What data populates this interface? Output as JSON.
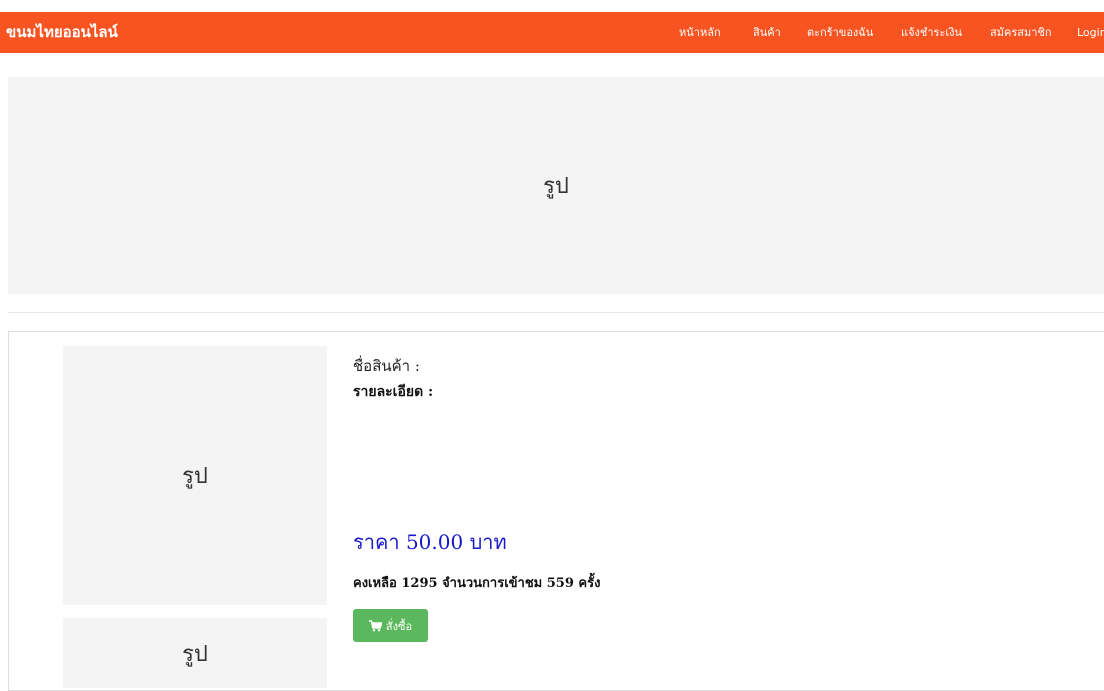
{
  "navbar": {
    "brand": "ขนมไทยออนไลน์",
    "items": [
      {
        "label": "หน้าหลัก"
      },
      {
        "label": "สินค้า"
      },
      {
        "label": "ตะกร้าของฉัน"
      },
      {
        "label": "แจ้งชำระเงิน"
      },
      {
        "label": "สมัครสมาชิก"
      },
      {
        "label": "Login"
      }
    ],
    "color": "#f75421"
  },
  "banner": {
    "placeholder": "รูป"
  },
  "product": {
    "image_placeholder": "รูป",
    "second_image_placeholder": "รูป",
    "name_label": "ชื่อสินค้า :",
    "detail_label": "รายละเอียด :",
    "price_prefix": "ราคา",
    "price_value": "50.00",
    "price_unit": "บาท",
    "price_color": "#1a1acc",
    "stock_text": "คงเหลือ 1295 จำนวนการเข้าชม 559 ครั้ง",
    "order_button": {
      "label": "สั่งซื้อ",
      "icon": "shopping-cart-icon",
      "color": "#5cb85c"
    }
  }
}
